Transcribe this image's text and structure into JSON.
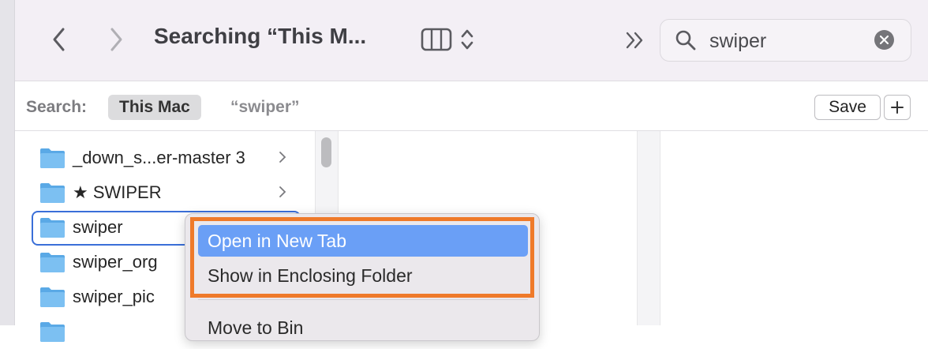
{
  "window": {
    "title": "Searching “This M...",
    "search_value": "swiper"
  },
  "scope_bar": {
    "label": "Search:",
    "scope": "This Mac",
    "query": "“swiper”",
    "save_label": "Save"
  },
  "files": [
    {
      "name": "_down_s...er-master 3",
      "has_children": true
    },
    {
      "name": "★ SWIPER",
      "has_children": true
    },
    {
      "name": "swiper",
      "has_children": false,
      "selected": true
    },
    {
      "name": "swiper_org",
      "has_children": false
    },
    {
      "name": "swiper_pic",
      "has_children": false
    }
  ],
  "context_menu": {
    "items": [
      {
        "label": "Open in New Tab",
        "highlighted": true
      },
      {
        "label": "Show in Enclosing Folder",
        "highlighted": false
      },
      {
        "label": "Move to Bin",
        "highlighted": false
      }
    ]
  },
  "colors": {
    "highlight_border": "#ef7a2a",
    "menu_highlight": "#6a9ff6",
    "selection_ring": "#3a6fd8",
    "folder": "#5aa9e6"
  },
  "icons": {
    "back": "chevron-left-icon",
    "forward": "chevron-right-icon",
    "view": "column-view-icon",
    "more": "double-chevron-right-icon",
    "search": "magnifier-icon",
    "clear": "clear-x-icon",
    "folder": "folder-icon"
  }
}
